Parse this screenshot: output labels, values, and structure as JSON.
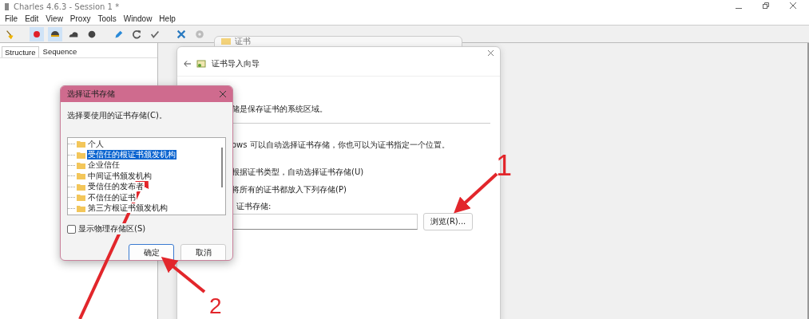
{
  "app": {
    "title": "Charles 4.6.3 - Session 1 *",
    "menu": [
      "File",
      "Edit",
      "View",
      "Proxy",
      "Tools",
      "Window",
      "Help"
    ],
    "toolbar": [
      {
        "kind": "broom",
        "on": false
      },
      {
        "kind": "record",
        "on": true
      },
      {
        "kind": "throttle",
        "on": true
      },
      {
        "kind": "turtle",
        "on": false
      },
      {
        "kind": "stop",
        "on": false
      },
      {
        "kind": "pen",
        "on": false
      },
      {
        "kind": "refresh",
        "on": false
      },
      {
        "kind": "check",
        "on": false
      },
      {
        "kind": "tools",
        "on": false
      },
      {
        "kind": "gear",
        "on": false
      }
    ],
    "tabs": [
      {
        "label": "Structure",
        "selected": true
      },
      {
        "label": "Sequence",
        "selected": false
      }
    ]
  },
  "background_window": {
    "title": "证书"
  },
  "wizard": {
    "title": "证书导入向导",
    "description": "储是保存证书的系统区域。",
    "hint": "ows 可以自动选择证书存储，你也可以为证书指定一个位置。",
    "options": [
      "根据证书类型，自动选择证书存储(U)",
      "将所有的证书都放入下列存储(P)"
    ],
    "store_label": "证书存储:",
    "browse_button": "浏览(R)..."
  },
  "dialog": {
    "title": "选择证书存储",
    "prompt": "选择要使用的证书存储(C)。",
    "stores": [
      {
        "label": "个人",
        "selected": false
      },
      {
        "label": "受信任的根证书颁发机构",
        "selected": true
      },
      {
        "label": "企业信任",
        "selected": false
      },
      {
        "label": "中间证书颁发机构",
        "selected": false
      },
      {
        "label": "受信任的发布者",
        "selected": false
      },
      {
        "label": "不信任的证书",
        "selected": false
      },
      {
        "label": "第三方根证书颁发机构",
        "selected": false
      }
    ],
    "show_physical": {
      "label": "显示物理存储区(S)",
      "checked": false
    },
    "buttons": [
      {
        "label": "确定",
        "default": true
      },
      {
        "label": "取消",
        "default": false
      }
    ]
  },
  "callouts": [
    {
      "number": "1"
    },
    {
      "number": "2"
    }
  ]
}
